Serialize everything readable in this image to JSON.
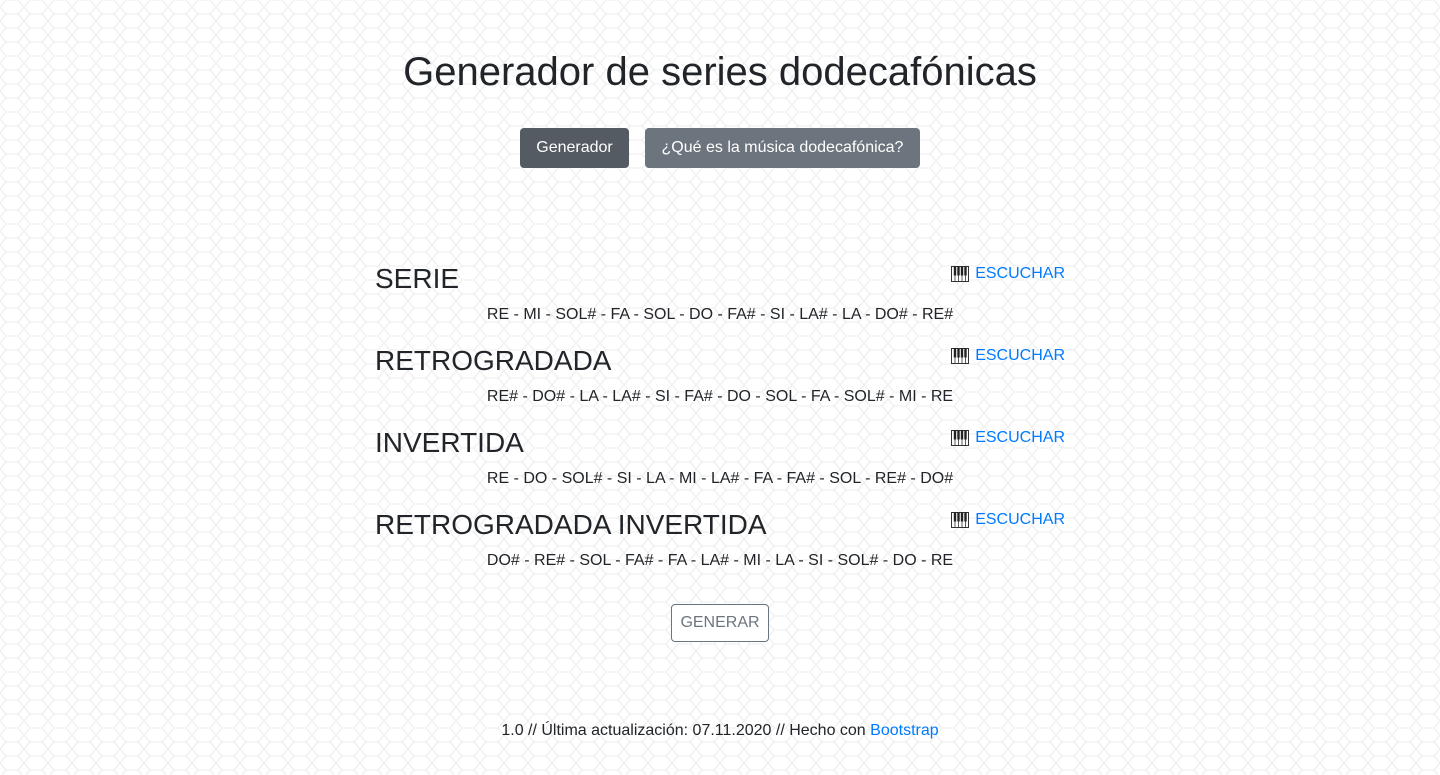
{
  "header": {
    "title": "Generador de series dodecafónicas"
  },
  "nav": {
    "generator_label": "Generador",
    "about_label": "¿Qué es la música dodecafónica?"
  },
  "rows": [
    {
      "title": "SERIE",
      "listen_label": "ESCUCHAR",
      "notes": "RE - MI - SOL# - FA - SOL - DO - FA# - SI - LA# - LA - DO# - RE#"
    },
    {
      "title": "RETROGRADADA",
      "listen_label": "ESCUCHAR",
      "notes": "RE# - DO# - LA - LA# - SI - FA# - DO - SOL - FA - SOL# - MI - RE"
    },
    {
      "title": "INVERTIDA",
      "listen_label": "ESCUCHAR",
      "notes": "RE - DO - SOL# - SI - LA - MI - LA# - FA - FA# - SOL - RE# - DO#"
    },
    {
      "title": "RETROGRADADA INVERTIDA",
      "listen_label": "ESCUCHAR",
      "notes": "DO# - RE# - SOL - FA# - FA - LA# - MI - LA - SI - SOL# - DO - RE"
    }
  ],
  "generate": {
    "label": "GENERAR"
  },
  "footer": {
    "text": "1.0 // Última actualización: 07.11.2020 // Hecho con",
    "link_label": "Bootstrap"
  },
  "icons": {
    "listen_icon": "piano-keyboard-icon"
  },
  "colors": {
    "link": "#007bff",
    "btn_active": "#545b62",
    "btn_secondary": "#6c757d",
    "text": "#212529"
  }
}
